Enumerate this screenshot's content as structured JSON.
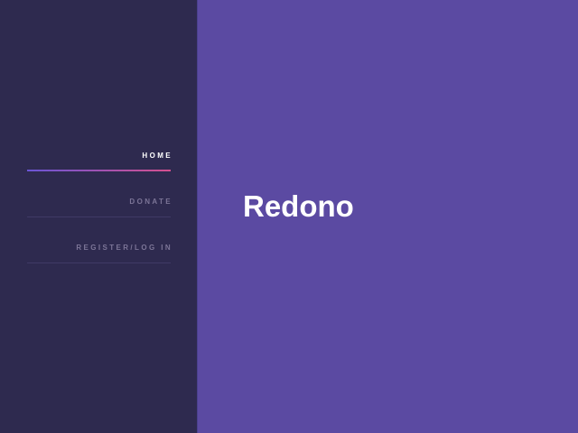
{
  "nav": {
    "items": [
      {
        "label": "HOME",
        "active": true
      },
      {
        "label": "DONATE",
        "active": false
      },
      {
        "label": "REGISTER/LOG IN",
        "active": false
      }
    ]
  },
  "main": {
    "title": "Redono"
  },
  "colors": {
    "background": "#5b4aa2",
    "sidebar": "#2e2a4f",
    "active_text": "#ffffff",
    "inactive_text": "#7c7597",
    "accent_start": "#6a55d6",
    "accent_end": "#d5508f"
  }
}
